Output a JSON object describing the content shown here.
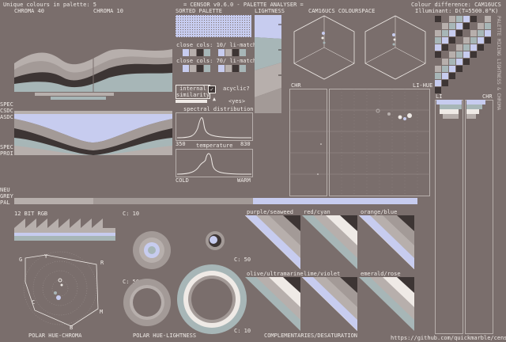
{
  "header": {
    "unique_colours": "Unique colours in palette: 5",
    "app_title": "= CENSOR v0.6.0 - PALETTE ANALYSER =",
    "colour_difference": "Colour difference: CAM16UCS",
    "illuminant": "Illuminant: D(T=5500.0°K)"
  },
  "panels": {
    "chroma_40": "CHROMA 40",
    "chroma_10": "CHROMA 10",
    "sorted_palette": "SORTED PALETTE",
    "lightness": "LIGHTNESS",
    "colourspace": "CAM16UCS COLOURSPACE",
    "close_cols_1": "close cols: 10/ li-match",
    "close_cols_2": "close cols: 70/ li-match",
    "internal_similarity": "internal similarity",
    "acyclic": "acyclic?",
    "acyclic_value": "<yes>",
    "spectral": "spectral distribution",
    "spec_left": "350",
    "spec_right": "830",
    "temperature": "temperature",
    "cold": "COLD",
    "warm": "WARM",
    "chr": "CHR",
    "li_hue": "LI-HUE",
    "li": "LI",
    "chr2": "CHR",
    "bit_rgb": "12 BIT RGB",
    "c10a": "C: 10",
    "c50a": "C: 50",
    "c50b": "C: 50",
    "c10b": "C: 10",
    "polar_hue_chroma": "POLAR HUE-CHROMA",
    "polar_hue_lightness": "POLAR HUE-LIGHTNESS",
    "complementaries": "COMPLEMENTARIES/DESATURATION",
    "github": "https://github.com/quickmarble/censor",
    "side_labels": [
      "SPEC",
      "CSDC",
      "ASDC",
      "SPEC",
      "PROI",
      "NEU",
      "GREY",
      "PAL"
    ],
    "hue_letters": [
      "G",
      "Y",
      "R",
      "M",
      "B",
      "C"
    ],
    "right_vertical": "PALETTE MIXING LIGHTNESS & CHROMA",
    "pairs": [
      "purple/seaweed",
      "red/cyan",
      "orange/blue",
      "olive/ultramarine",
      "lime/violet",
      "emerald/rose"
    ]
  },
  "palette_colours": [
    "#3d3534",
    "#7a6e6c",
    "#b7afac",
    "#a7b6b7",
    "#c7ccef"
  ],
  "colors": {
    "bg": "#7a6e6c",
    "dark": "#3d3534",
    "mid": "#a39a97",
    "light": "#efeae6",
    "blue": "#c7ccef",
    "teal": "#a7b6b7"
  }
}
